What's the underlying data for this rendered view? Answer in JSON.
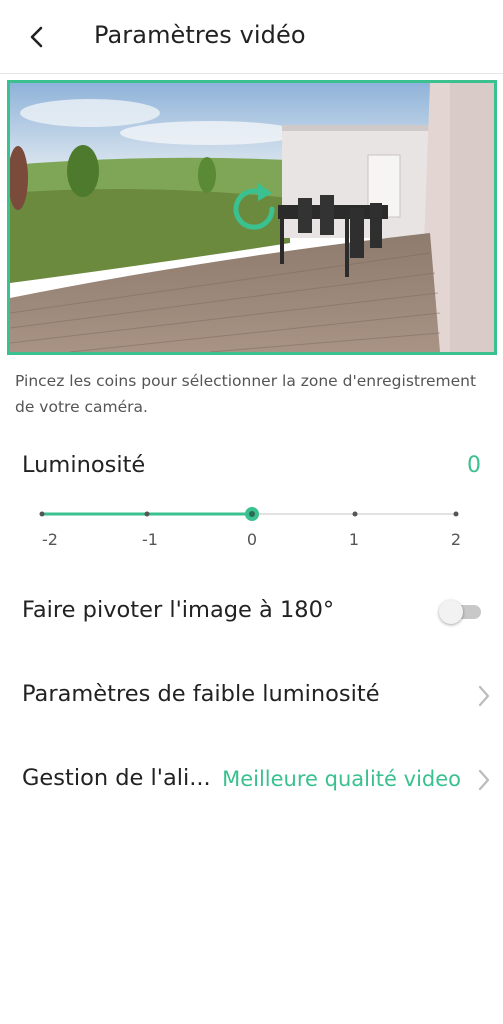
{
  "header": {
    "title": "Paramètres vidéo"
  },
  "preview": {
    "hint": "Pincez les coins pour sélectionner la zone d'enregistrement de votre caméra.",
    "rotate_icon": "refresh-icon"
  },
  "brightness": {
    "label": "Luminosité",
    "value": "0",
    "ticks": [
      "-2",
      "-1",
      "0",
      "1",
      "2"
    ],
    "selected_index": 2
  },
  "rotate": {
    "label": "Faire pivoter l'image à 180°",
    "enabled": false
  },
  "low_light": {
    "label": "Paramètres de faible luminosité"
  },
  "power": {
    "label": "Gestion de l'ali...",
    "value": "Meilleure qualité video"
  },
  "colors": {
    "accent": "#3ac18f",
    "text": "#222222",
    "secondary_text": "#555555"
  }
}
